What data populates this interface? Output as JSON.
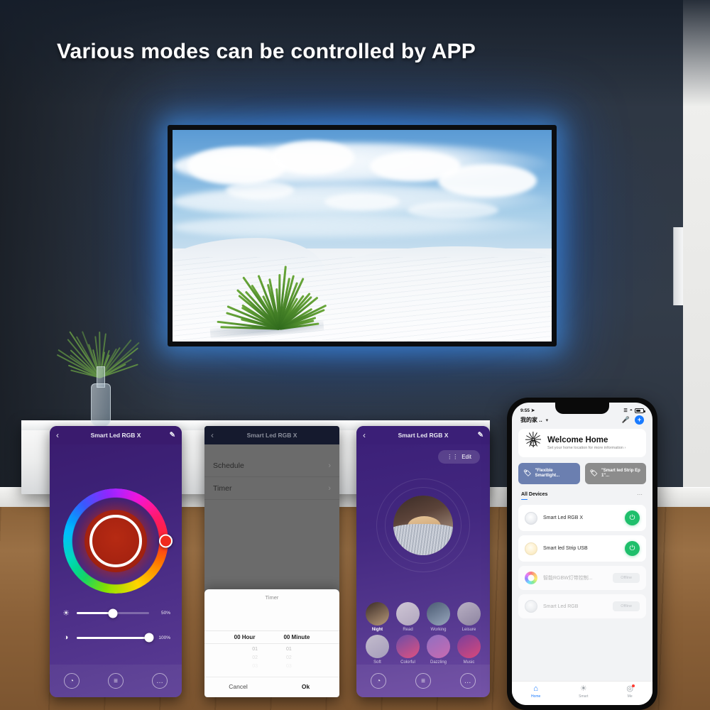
{
  "banner": {
    "title": "Various modes can be controlled by APP"
  },
  "tv": {
    "scene_description": "White sand desert dunes with blue sky, clouds and a green yucca plant",
    "backlight_color": "#3c96ff"
  },
  "shot_color": {
    "header": {
      "back_icon": "chevron-left-icon",
      "title": "Smart Led RGB X",
      "edit_icon": "pencil-icon"
    },
    "wheel": {
      "selected_color": "#f02b1d"
    },
    "sliders": [
      {
        "icon": "brightness-icon",
        "glyph": "☀",
        "value": "50%",
        "percent": 50
      },
      {
        "icon": "color-temperature-icon",
        "glyph": "◑",
        "value": "100%",
        "percent": 100
      }
    ],
    "tabs": [
      {
        "name": "palette-tab",
        "glyph": "◔"
      },
      {
        "name": "scene-tab",
        "glyph": "≡"
      },
      {
        "name": "more-tab",
        "glyph": "…"
      }
    ]
  },
  "shot_timer": {
    "header": {
      "back_icon": "chevron-left-icon",
      "title": "Smart Led RGB X"
    },
    "menu": [
      {
        "label": "Schedule"
      },
      {
        "label": "Timer"
      }
    ],
    "sheet": {
      "title": "Timer",
      "columns": [
        {
          "header": "00 Hour",
          "values": [
            "01",
            "02",
            "03"
          ]
        },
        {
          "header": "00 Minute",
          "values": [
            "01",
            "02",
            "03"
          ]
        }
      ],
      "cancel_label": "Cancel",
      "ok_label": "Ok"
    }
  },
  "shot_scene": {
    "header": {
      "back_icon": "chevron-left-icon",
      "title": "Smart Led RGB X",
      "edit_icon": "pencil-icon"
    },
    "edit_button": {
      "label": "Edit",
      "icon": "sliders-icon"
    },
    "hero": {
      "description": "Sleeping dog on a bed"
    },
    "scenes": [
      {
        "label": "Night",
        "active": true,
        "color1": "#3a2b26",
        "color2": "#b89a7a"
      },
      {
        "label": "Read",
        "active": false,
        "color1": "#cfc6d6",
        "color2": "#b0a6bd"
      },
      {
        "label": "Working",
        "active": false,
        "color1": "#4a5a72",
        "color2": "#98a7bd"
      },
      {
        "label": "Leisure",
        "active": false,
        "color1": "#b9b0c4",
        "color2": "#8d84a0"
      },
      {
        "label": "Soft",
        "active": false,
        "color1": "#c3bccd",
        "color2": "#a59dba"
      },
      {
        "label": "Colorful",
        "active": false,
        "color1": "#6c4ea8",
        "color2": "#e0507f"
      },
      {
        "label": "Dazzling",
        "active": false,
        "color1": "#8f6fc2",
        "color2": "#c96ab0"
      },
      {
        "label": "Music",
        "active": false,
        "color1": "#7a3f9c",
        "color2": "#d9487a"
      }
    ],
    "tabs": [
      {
        "name": "palette-tab",
        "glyph": "◔"
      },
      {
        "name": "scene-tab",
        "glyph": "≡"
      },
      {
        "name": "more-tab",
        "glyph": "…"
      }
    ]
  },
  "iphone": {
    "status": {
      "time": "9:55",
      "location_icon": "location-arrow-icon",
      "signal_icon": "signal-icon",
      "wifi_icon": "wifi-icon",
      "battery_icon": "battery-icon"
    },
    "home_name": "我的家 ..",
    "mic_icon": "microphone-icon",
    "add_label": "+",
    "welcome": {
      "icon": "sun-icon",
      "title": "Welcome Home",
      "subtitle": "Set your home location for more information ›"
    },
    "tags": [
      {
        "label": "\"Flexible Smartlight...",
        "icon": "tag-icon",
        "color": "#6b7fb0"
      },
      {
        "label": "\"Smart led Strip Ep 1\"...",
        "icon": "tag-icon",
        "color": "#8c8c8c"
      }
    ],
    "devices_header": {
      "title": "All Devices",
      "more_icon": "ellipsis-icon"
    },
    "devices": [
      {
        "name": "Smart Led RGB X",
        "icon": "bulb-icon",
        "online": true,
        "power_glyph": "⏻"
      },
      {
        "name": "Smart led Strip USB",
        "icon": "warm-bulb-icon",
        "online": true,
        "power_glyph": "⏻"
      },
      {
        "name": "智能RGBW灯带控制...",
        "icon": "rgb-ring-icon",
        "online": false,
        "status_label": "Offline"
      },
      {
        "name": "Smart Led RGB",
        "icon": "bulb-icon",
        "online": false,
        "status_label": "Offline"
      }
    ],
    "nav": [
      {
        "label": "Home",
        "glyph": "⌂",
        "active": true,
        "badge": false
      },
      {
        "label": "Smart",
        "glyph": "☀",
        "active": false,
        "badge": false
      },
      {
        "label": "Me",
        "glyph": "◎",
        "active": false,
        "badge": true
      }
    ]
  }
}
